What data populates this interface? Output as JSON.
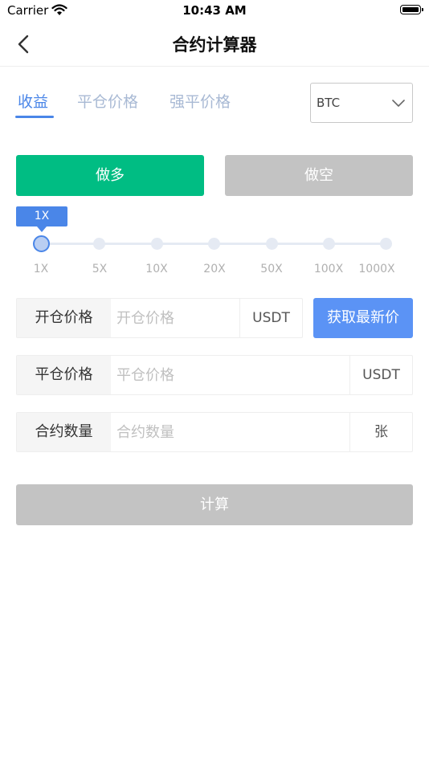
{
  "status_bar": {
    "carrier": "Carrier",
    "time": "10:43 AM"
  },
  "nav": {
    "title": "合约计算器"
  },
  "tabs": [
    {
      "label": "收益",
      "active": true
    },
    {
      "label": "平仓价格",
      "active": false
    },
    {
      "label": "强平价格",
      "active": false
    }
  ],
  "currency_select": {
    "value": "BTC"
  },
  "direction": {
    "long_label": "做多",
    "short_label": "做空"
  },
  "leverage": {
    "current_label": "1X",
    "options": [
      "1X",
      "5X",
      "10X",
      "20X",
      "50X",
      "100X",
      "1000X"
    ],
    "selected_index": 0
  },
  "open_price": {
    "label": "开仓价格",
    "placeholder": "开仓价格",
    "unit": "USDT",
    "value": ""
  },
  "latest_price_button": "获取最新价",
  "close_price": {
    "label": "平仓价格",
    "placeholder": "平仓价格",
    "unit": "USDT",
    "value": ""
  },
  "quantity": {
    "label": "合约数量",
    "placeholder": "合约数量",
    "unit": "张",
    "value": ""
  },
  "calculate_button": "计算",
  "colors": {
    "accent": "#4a86e8",
    "long": "#00bd83",
    "disabled": "#c3c3c3",
    "tab_inactive": "#a8b9d4"
  }
}
